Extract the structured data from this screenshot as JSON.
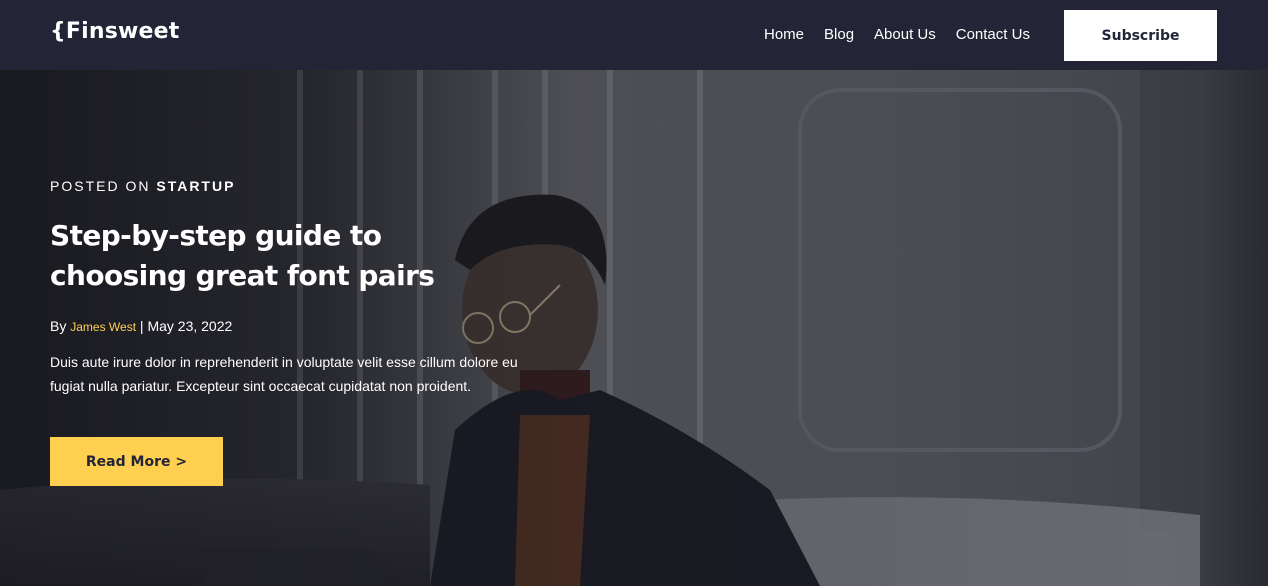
{
  "navbar": {
    "logo": "{Finsweet",
    "links": [
      "Home",
      "Blog",
      "About Us",
      "Contact Us"
    ],
    "subscribe_label": "Subscribe"
  },
  "hero": {
    "posted_on_prefix": "POSTED ON ",
    "category": "STARTUP",
    "title": "Step-by-step guide to choosing great font pairs",
    "by_prefix": "By ",
    "author": "James West",
    "separator": " | ",
    "date": "May 23, 2022",
    "excerpt": "Duis aute irure dolor in reprehenderit in voluptate velit esse cillum dolore eu fugiat nulla pariatur. Excepteur sint occaecat cupidatat non proident.",
    "read_more_label": "Read More >"
  },
  "colors": {
    "background": "#232536",
    "accent": "#ffd050",
    "text": "#ffffff"
  }
}
